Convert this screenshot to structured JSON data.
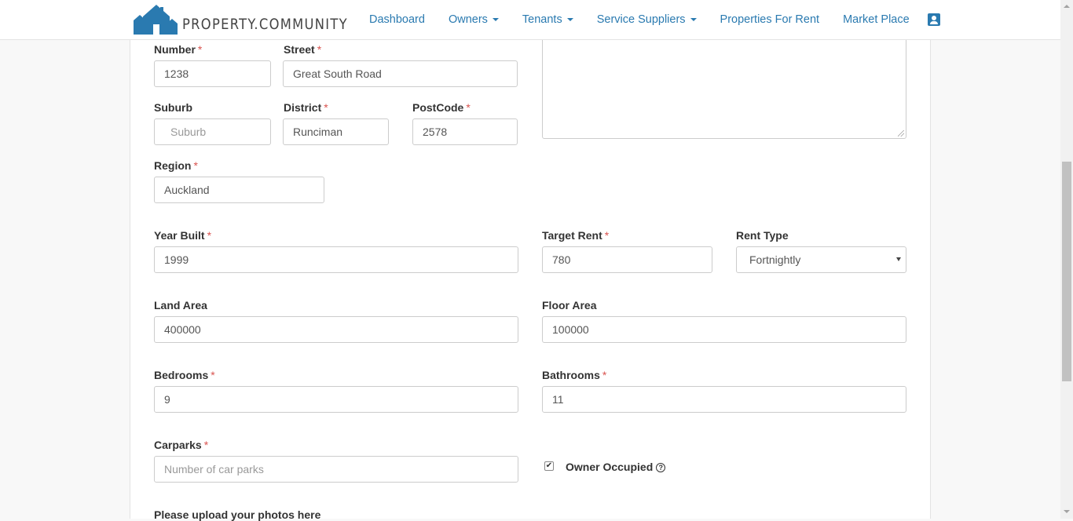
{
  "brand": {
    "name": "PROPERTY.COMMUNITY",
    "color": "#2a7ab0"
  },
  "nav": {
    "items": [
      {
        "label": "Dashboard",
        "dropdown": false
      },
      {
        "label": "Owners",
        "dropdown": true
      },
      {
        "label": "Tenants",
        "dropdown": true
      },
      {
        "label": "Service Suppliers",
        "dropdown": true
      },
      {
        "label": "Properties For Rent",
        "dropdown": false
      },
      {
        "label": "Market Place",
        "dropdown": false
      }
    ],
    "profile_icon": "user-profile-icon"
  },
  "form": {
    "number": {
      "label": "Number",
      "value": "1238"
    },
    "street": {
      "label": "Street",
      "value": "Great South Road"
    },
    "suburb": {
      "label": "Suburb",
      "placeholder": "Suburb"
    },
    "district": {
      "label": "District",
      "value": "Runciman"
    },
    "postcode": {
      "label": "PostCode",
      "value": "2578"
    },
    "region": {
      "label": "Region",
      "value": "Auckland"
    },
    "year_built": {
      "label": "Year Built",
      "value": "1999"
    },
    "target_rent": {
      "label": "Target Rent",
      "value": "780"
    },
    "rent_type": {
      "label": "Rent Type",
      "value": "Fortnightly"
    },
    "land_area": {
      "label": "Land Area",
      "value": "400000"
    },
    "floor_area": {
      "label": "Floor Area",
      "value": "100000"
    },
    "bedrooms": {
      "label": "Bedrooms",
      "value": "9"
    },
    "bathrooms": {
      "label": "Bathrooms",
      "value": "11"
    },
    "carparks": {
      "label": "Carparks",
      "placeholder": "Number of car parks"
    },
    "owner_occupied": {
      "label": "Owner Occupied",
      "checked": true,
      "check_glyph": "✔",
      "help_glyph": "?"
    },
    "upload_heading": "Please upload your photos here",
    "required_marker": "*"
  }
}
